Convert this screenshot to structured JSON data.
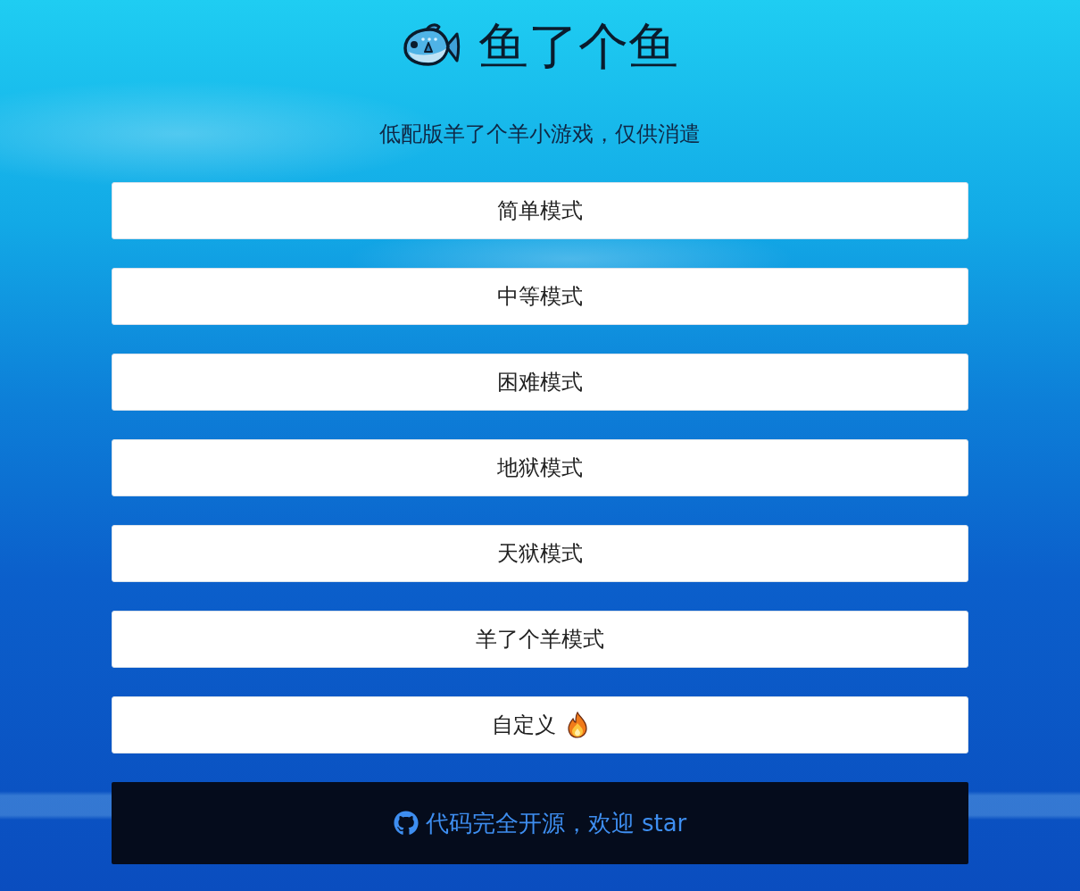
{
  "header": {
    "title": "鱼了个鱼",
    "subtitle": "低配版羊了个羊小游戏，仅供消遣"
  },
  "modes": [
    {
      "label": "简单模式",
      "kind": "plain"
    },
    {
      "label": "中等模式",
      "kind": "plain"
    },
    {
      "label": "困难模式",
      "kind": "plain"
    },
    {
      "label": "地狱模式",
      "kind": "plain"
    },
    {
      "label": "天狱模式",
      "kind": "plain"
    },
    {
      "label": "羊了个羊模式",
      "kind": "plain"
    },
    {
      "label": "自定义",
      "kind": "hot"
    }
  ],
  "footer": {
    "text": "代码完全开源，欢迎 star"
  }
}
